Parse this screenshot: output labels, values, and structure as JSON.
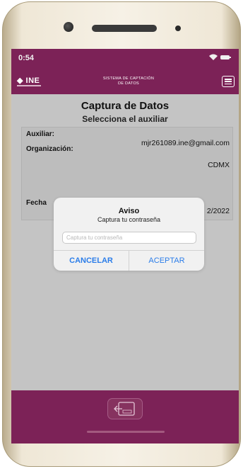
{
  "status_bar": {
    "time": "0:54",
    "icons": "•• ▲ ▬"
  },
  "app_bar": {
    "logo_text": "◆ INE",
    "system_title_line1": "SISTEMA DE CAPTACIÓN",
    "system_title_line2": "DE DATOS",
    "menu_icon": "hamburger-icon"
  },
  "page": {
    "title": "Captura de Datos",
    "subtitle": "Selecciona el auxiliar"
  },
  "card": {
    "auxiliar_label": "Auxiliar:",
    "auxiliar_value": "mjr261089.ine@gmail.com",
    "organizacion_label": "Organización:",
    "organizacion_value": "CDMX",
    "fecha_label": "Fecha",
    "fecha_value": "2/2022"
  },
  "dialog": {
    "title": "Aviso",
    "message": "Captura tu contraseña",
    "input_placeholder": "Captura tu contraseña",
    "input_value": "",
    "cancel_label": "CANCELAR",
    "accept_label": "ACEPTAR"
  },
  "bottom_bar": {
    "exit_icon": "logout-icon"
  },
  "colors": {
    "brand": "#7c2257",
    "dialog_button": "#2b7de9",
    "screen_bg": "#c4c4c4"
  }
}
